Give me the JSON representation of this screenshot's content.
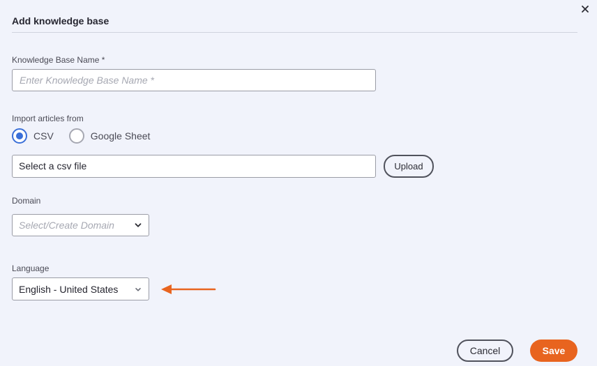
{
  "dialog": {
    "title": "Add knowledge base"
  },
  "form": {
    "name": {
      "label": "Knowledge Base Name *",
      "placeholder": "Enter Knowledge Base Name *",
      "value": ""
    },
    "import": {
      "label": "Import articles from",
      "options": [
        {
          "label": "CSV",
          "selected": true
        },
        {
          "label": "Google Sheet",
          "selected": false
        }
      ],
      "file_text": "Select a csv file",
      "upload_label": "Upload"
    },
    "domain": {
      "label": "Domain",
      "placeholder": "Select/Create Domain"
    },
    "language": {
      "label": "Language",
      "value": "English - United States"
    }
  },
  "footer": {
    "cancel_label": "Cancel",
    "save_label": "Save"
  },
  "colors": {
    "accent": "#3a6fd8",
    "primary": "#e8641f",
    "annotation_arrow": "#e8641f",
    "background": "#f1f3fb"
  },
  "icons": {
    "close": "close-icon",
    "chevron": "chevron-down-icon",
    "arrow": "arrow-left-icon"
  }
}
